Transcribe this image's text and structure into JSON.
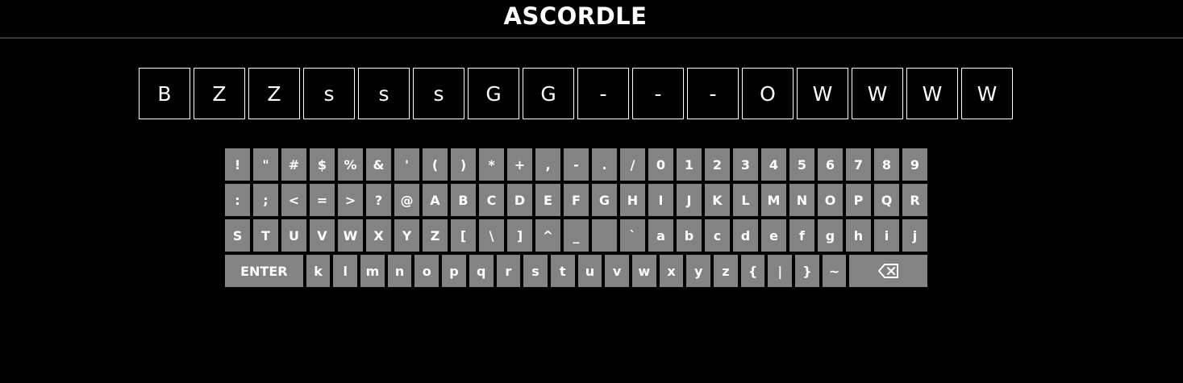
{
  "header": {
    "title": "ASCORDLE"
  },
  "board": {
    "tiles": [
      "B",
      "Z",
      "Z",
      "s",
      "s",
      "s",
      "G",
      "G",
      "-",
      "-",
      "-",
      "O",
      "W",
      "W",
      "W",
      "W"
    ]
  },
  "keyboard": {
    "rows": [
      [
        "!",
        "\"",
        "#",
        "$",
        "%",
        "&",
        "'",
        "(",
        ")",
        "*",
        "+",
        ",",
        "-",
        ".",
        "/",
        "0",
        "1",
        "2",
        "3",
        "4",
        "5",
        "6",
        "7",
        "8",
        "9"
      ],
      [
        ":",
        ";",
        "<",
        "=",
        ">",
        "?",
        "@",
        "A",
        "B",
        "C",
        "D",
        "E",
        "F",
        "G",
        "H",
        "I",
        "J",
        "K",
        "L",
        "M",
        "N",
        "O",
        "P",
        "Q",
        "R"
      ],
      [
        "S",
        "T",
        "U",
        "V",
        "W",
        "X",
        "Y",
        "Z",
        "[",
        "\\",
        "]",
        "^",
        "_",
        " ",
        "`",
        "a",
        "b",
        "c",
        "d",
        "e",
        "f",
        "g",
        "h",
        "i",
        "j"
      ],
      [
        "k",
        "l",
        "m",
        "n",
        "o",
        "p",
        "q",
        "r",
        "s",
        "t",
        "u",
        "v",
        "w",
        "x",
        "y",
        "z",
        "{",
        "|",
        "}",
        "~"
      ]
    ],
    "enter_label": "ENTER",
    "backspace_icon": "backspace-icon"
  },
  "colors": {
    "background": "#000000",
    "key": "#818384",
    "divider": "#3a3a3c",
    "text": "#ffffff"
  }
}
